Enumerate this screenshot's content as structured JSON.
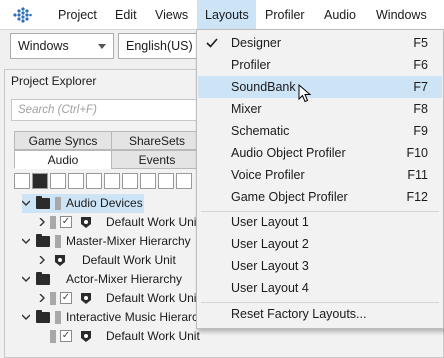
{
  "menubar": {
    "items": [
      "Project",
      "Edit",
      "Views",
      "Layouts",
      "Profiler",
      "Audio",
      "Windows"
    ],
    "active": "Layouts"
  },
  "toolbar": {
    "platform": "Windows",
    "language": "English(US) (I"
  },
  "explorer": {
    "title": "Project Explorer",
    "search_placeholder": "Search (Ctrl+F)",
    "tabs_row1": [
      "Game Syncs",
      "ShareSets"
    ],
    "tabs_row2": [
      "Audio",
      "Events"
    ],
    "selected_tab": "Audio",
    "tree": [
      {
        "label": "Audio Devices"
      },
      {
        "label": "Default Work Unit"
      },
      {
        "label": "Master-Mixer Hierarchy"
      },
      {
        "label": "Default Work Unit"
      },
      {
        "label": "Actor-Mixer Hierarchy"
      },
      {
        "label": "Default Work Unit"
      },
      {
        "label": "Interactive Music Hierarch"
      },
      {
        "label": "Default Work Unit"
      }
    ]
  },
  "layouts_menu": {
    "items": [
      {
        "label": "Designer",
        "shortcut": "F5",
        "checked": true
      },
      {
        "label": "Profiler",
        "shortcut": "F6"
      },
      {
        "label": "SoundBank",
        "shortcut": "F7",
        "highlighted": true
      },
      {
        "label": "Mixer",
        "shortcut": "F8"
      },
      {
        "label": "Schematic",
        "shortcut": "F9"
      },
      {
        "label": "Audio Object Profiler",
        "shortcut": "F10"
      },
      {
        "label": "Voice Profiler",
        "shortcut": "F11"
      },
      {
        "label": "Game Object Profiler",
        "shortcut": "F12"
      },
      {
        "label": "User Layout 1",
        "shortcut": ""
      },
      {
        "label": "User Layout 2",
        "shortcut": ""
      },
      {
        "label": "User Layout 3",
        "shortcut": ""
      },
      {
        "label": "User Layout 4",
        "shortcut": ""
      },
      {
        "label": "Reset Factory Layouts...",
        "shortcut": ""
      }
    ]
  },
  "colors": {
    "highlight": "#cde4f7",
    "logo": "#2f6fb5"
  }
}
